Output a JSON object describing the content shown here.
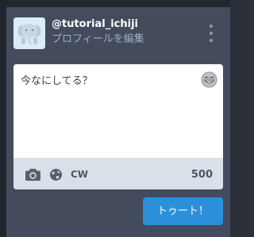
{
  "account": {
    "username": "@tutorial_ichiji",
    "edit_profile_label": "プロフィールを編集",
    "avatar_icon": "elephant-icon"
  },
  "menu_icon": "kebab-menu-icon",
  "compose": {
    "placeholder": "今なにしてる？",
    "emoji_icon": "grinning-emoji-icon",
    "media_icon": "camera-icon",
    "privacy_icon": "globe-icon",
    "cw_label": "CW",
    "char_count": "500",
    "submit_label": "トゥート！"
  },
  "colors": {
    "panel_bg": "#444b5d",
    "accent": "#2b90d9",
    "options_bar": "#d9e1e8",
    "secondary_text": "#9baec8"
  }
}
